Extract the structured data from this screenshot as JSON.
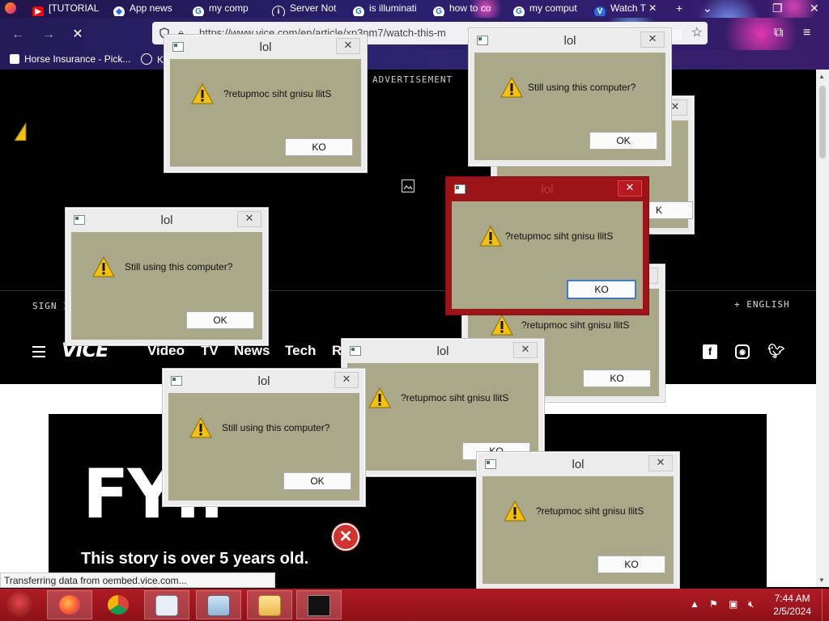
{
  "browser": {
    "tabs": [
      {
        "label": "",
        "icon": "firefox-icon"
      },
      {
        "label": "[TUTORIAL",
        "icon": "youtube-icon"
      },
      {
        "label": "App news",
        "icon": "app-icon"
      },
      {
        "label": "my comp",
        "icon": "google-icon"
      },
      {
        "label": "Server Not",
        "icon": "info-icon"
      },
      {
        "label": "is illuminati",
        "icon": "google-icon"
      },
      {
        "label": "how to co",
        "icon": "google-icon"
      },
      {
        "label": "my comput",
        "icon": "google-icon"
      },
      {
        "label": "Watch T",
        "icon": "vice-icon",
        "active": true
      }
    ],
    "url": "https://www.vice.com/en/article/xp3nm7/watch-this-m",
    "bookmarks": [
      {
        "label": "Horse Insurance - Pick..."
      },
      {
        "label": "Ke"
      }
    ],
    "status_text": "Transferring data from oembed.vice.com..."
  },
  "page": {
    "ad_label": "ADVERTISEMENT",
    "sign_in": "SIGN I",
    "language": "+ ENGLISH",
    "logo": "VICE",
    "nav_links": [
      "Video",
      "TV",
      "News",
      "Tech",
      "R"
    ],
    "hero_title": "FYI.",
    "hero_subtitle": "This story is over 5 years old."
  },
  "dialogs": [
    {
      "title": "lol",
      "message": "?retupmoc siht gnisu llitS",
      "button": "KO"
    },
    {
      "title": "lol",
      "message": "Still using this computer?",
      "button": "OK"
    },
    {
      "title": "",
      "message": "",
      "button": "K"
    },
    {
      "title": "lol",
      "message": "Still using this computer?",
      "button": "OK"
    },
    {
      "title": "",
      "message": "?retupmoc siht gnisu llitS",
      "button": "KO"
    },
    {
      "title": "lol",
      "message": "?retupmoc siht gnisu llitS",
      "button": "KO",
      "active": true
    },
    {
      "title": "lol",
      "message": "?retupmoc siht gnisu llitS",
      "button": "KO"
    },
    {
      "title": "lol",
      "message": "Still using this computer?",
      "button": "OK"
    },
    {
      "title": "lol",
      "message": "?retupmoc siht gnisu llitS",
      "button": "KO"
    }
  ],
  "taskbar": {
    "apps": [
      "firefox-icon",
      "chrome-icon",
      "program-window-icon",
      "control-panel-icon",
      "file-explorer-icon",
      "command-prompt-icon"
    ],
    "time": "7:44 AM",
    "date": "2/5/2024"
  },
  "colors": {
    "dialog_body": "#aba789",
    "active_dialog_frame": "#9e1318",
    "taskbar": "#a0161e",
    "chrome_bg": "#2d2470"
  }
}
